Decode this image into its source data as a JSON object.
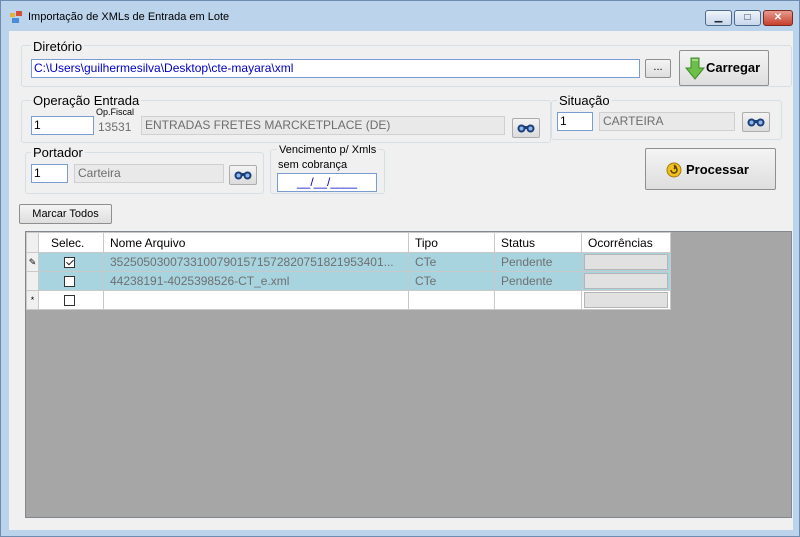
{
  "window": {
    "title": "Importação de XMLs de Entrada em Lote",
    "controls": {
      "minimize": "▁",
      "maximize": "□",
      "close": "✕"
    }
  },
  "diretorio": {
    "label": "Diretório",
    "path": "C:\\Users\\guilhermesilva\\Desktop\\cte-mayara\\xml",
    "browse_label": "...",
    "carregar_label": "Carregar"
  },
  "operacao": {
    "label": "Operação Entrada",
    "code": "1",
    "op_fiscal_label": "Op.Fiscal",
    "op_fiscal": "13531",
    "description": "ENTRADAS FRETES MARCKETPLACE (DE)"
  },
  "situacao": {
    "label": "Situação",
    "code": "1",
    "description": "CARTEIRA"
  },
  "portador": {
    "label": "Portador",
    "code": "1",
    "description": "Carteira"
  },
  "vencimento": {
    "label_line1": "Vencimento p/ Xmls",
    "label_line2": "sem cobrança",
    "value": "__/__/____"
  },
  "processar_label": "Processar",
  "marcar_todos_label": "Marcar Todos",
  "grid": {
    "columns": [
      "Selec.",
      "Nome Arquivo",
      "Tipo",
      "Status",
      "Ocorrências"
    ],
    "rows": [
      {
        "indicator": "✎",
        "checked": true,
        "nome": "35250503007331007901571572820751821953401...",
        "tipo": "CTe",
        "status": "Pendente"
      },
      {
        "indicator": "",
        "checked": false,
        "nome": "44238191-4025398526-CT_e.xml",
        "tipo": "CTe",
        "status": "Pendente"
      }
    ],
    "new_row_indicator": "*"
  },
  "colors": {
    "selected_row": "#a8d4e0",
    "grid_bg": "#a6a6a6",
    "window_frame": "#bcd3ec"
  }
}
